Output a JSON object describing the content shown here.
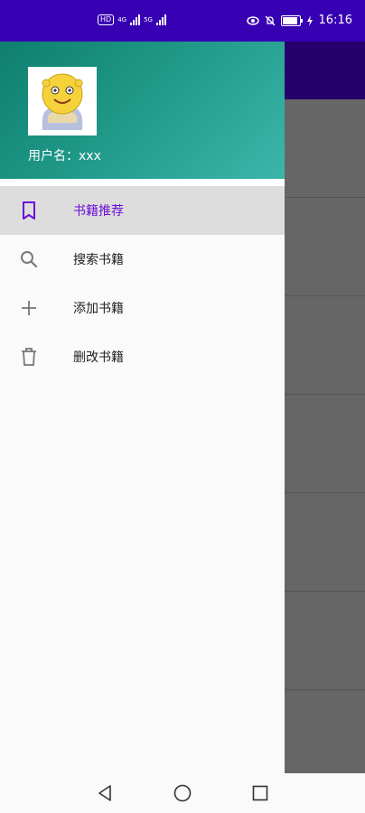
{
  "status_bar": {
    "network_badge": "HD",
    "signal_1_label": "4G",
    "signal_2_label": "5G",
    "battery_level": 0.8,
    "time": "16:16",
    "icons": [
      "eye-icon",
      "bell-off-icon",
      "battery-icon",
      "charging-icon"
    ]
  },
  "drawer": {
    "header": {
      "avatar_icon": "avatar-cartoon",
      "username": "用户名：xxx",
      "gradient_colors": [
        "#0f7f6e",
        "#3bb6aa"
      ]
    },
    "menu": [
      {
        "label": "书籍推荐",
        "icon": "bookmark-icon",
        "active": true
      },
      {
        "label": "搜索书籍",
        "icon": "search-icon",
        "active": false
      },
      {
        "label": "添加书籍",
        "icon": "plus-icon",
        "active": false
      },
      {
        "label": "删改书籍",
        "icon": "trash-icon",
        "active": false
      }
    ],
    "accent_color": "#6a0fd6"
  },
  "nav_bar": {
    "buttons": [
      "back-icon",
      "home-icon",
      "recents-icon"
    ]
  }
}
